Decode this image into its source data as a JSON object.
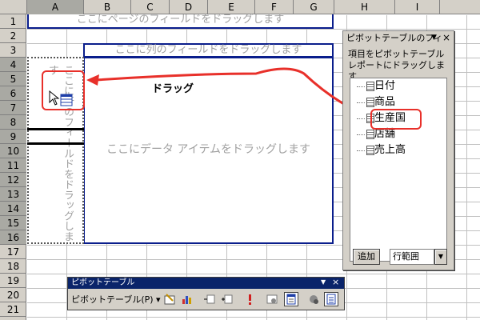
{
  "columns": [
    "A",
    "B",
    "C",
    "D",
    "E",
    "F",
    "G",
    "H",
    "I"
  ],
  "rows": [
    "1",
    "2",
    "3",
    "4",
    "5",
    "6",
    "7",
    "8",
    "9",
    "10",
    "11",
    "12",
    "13",
    "14",
    "15",
    "16",
    "17",
    "18",
    "19",
    "20",
    "21"
  ],
  "pivot": {
    "page_zone": "ここにページのフィールドをドラッグします",
    "column_zone": "ここに列のフィールドをドラッグします",
    "data_zone": "ここにデータ アイテムをドラッグします",
    "row_zone": "ここに行のフィールドをドラッグします"
  },
  "annotation": {
    "label": "ドラッグ",
    "color": "#e8302a"
  },
  "field_panel": {
    "title": "ピボットテーブルのフィ",
    "description": "項目をピボットテーブル レポートにドラッグします",
    "fields": [
      "日付",
      "商品",
      "生産国",
      "店舗",
      "売上高"
    ],
    "highlighted_field": "生産国",
    "add_button": "追加",
    "area_select": "行範囲"
  },
  "toolbar": {
    "title": "ピボットテーブル",
    "menu_label": "ピボットテーブル(P)",
    "icons": [
      "format-report-icon",
      "chart-wizard-icon",
      "hide-detail-icon",
      "show-detail-icon",
      "refresh-icon",
      "field-settings-icon",
      "field-list-icon",
      "hide-items-icon",
      "always-display-icon"
    ]
  },
  "colors": {
    "zone_border": "#0a1e8c",
    "accent_red": "#e8302a",
    "title_bar": "#0a246a"
  }
}
